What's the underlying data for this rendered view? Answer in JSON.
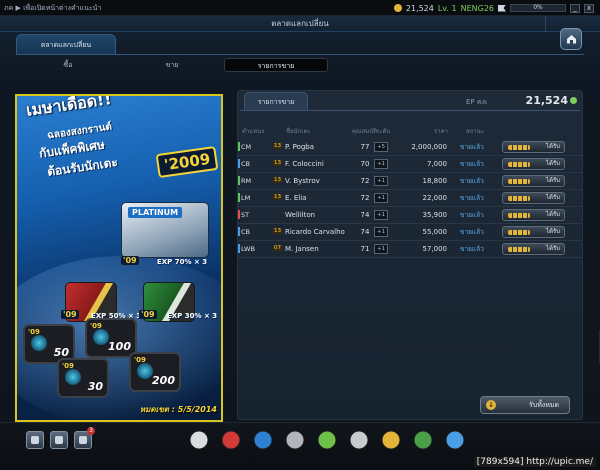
{
  "topbar": {
    "left_text": "ภค ▶ เพื่อเปิดหน้าต่างคำแนะนำ",
    "coins": "21,524",
    "level": "Lv. 1",
    "username": "NENG26",
    "progress_text": "0%",
    "minimize": "_",
    "close": "x"
  },
  "window": {
    "title": "ตลาดแลกเปลี่ยน",
    "main_tab": "ตลาดแลกเปลี่ยน",
    "subtabs": [
      "ซื้อ",
      "ขาย",
      "รายการขาย"
    ],
    "active_subtab": 2
  },
  "promo": {
    "headline": "เมษาเดือด!!",
    "line2": "ฉลองสงกรานต์",
    "line3": "กับแพ็คพิเศษ",
    "line4": "ต้อนรับนักเตะ",
    "year": "'2009",
    "platinum_label": "PLATINUM",
    "tag09": "'09",
    "exp_platinum": "EXP 70% × 3",
    "exp_red": "EXP 50% × 3",
    "exp_green": "EXP 30% × 3",
    "card_values": [
      "50",
      "100",
      "30",
      "200"
    ],
    "deadline": "หมดเขต : 5/5/2014"
  },
  "panel": {
    "tab": "รายการขาย",
    "ep_label": "EP คงเ",
    "ep_value": "21,524",
    "columns": [
      "ตำแหน่ง",
      "ชื่อนักเตะ",
      "คุณสมบัติ",
      "ระดับ",
      "ราคา",
      "สถานะ"
    ],
    "rows": [
      {
        "pos": "CM",
        "pos_color": "#5ac85a",
        "season": "13",
        "name": "P. Pogba",
        "ovr": "77",
        "lvl": "+5",
        "price": "2,000,000",
        "status": "ขายแล้ว",
        "action": "ได้รับ"
      },
      {
        "pos": "CB",
        "pos_color": "#4aa0e8",
        "season": "13",
        "name": "F. Coloccini",
        "ovr": "70",
        "lvl": "+1",
        "price": "7,000",
        "status": "ขายแล้ว",
        "action": "ได้รับ"
      },
      {
        "pos": "RM",
        "pos_color": "#5ac85a",
        "season": "13",
        "name": "V. Bystrov",
        "ovr": "72",
        "lvl": "+1",
        "price": "18,800",
        "status": "ขายแล้ว",
        "action": "ได้รับ"
      },
      {
        "pos": "LM",
        "pos_color": "#5ac85a",
        "season": "13",
        "name": "E. Elia",
        "ovr": "72",
        "lvl": "+1",
        "price": "22,000",
        "status": "ขายแล้ว",
        "action": "ได้รับ"
      },
      {
        "pos": "ST",
        "pos_color": "#e05050",
        "season": "",
        "name": "Wellilton",
        "ovr": "74",
        "lvl": "+1",
        "price": "35,900",
        "status": "ขายแล้ว",
        "action": "ได้รับ"
      },
      {
        "pos": "CB",
        "pos_color": "#4aa0e8",
        "season": "13",
        "name": "Ricardo Carvalho",
        "ovr": "74",
        "lvl": "+1",
        "price": "55,000",
        "status": "ขายแล้ว",
        "action": "ได้รับ"
      },
      {
        "pos": "LWB",
        "pos_color": "#4aa0e8",
        "season": "07",
        "name": "M. Jansen",
        "ovr": "71",
        "lvl": "+1",
        "price": "57,000",
        "status": "ขายแล้ว",
        "action": "ได้รับ"
      }
    ],
    "receive_all": "รับทั้งหมด"
  },
  "bottombar": {
    "mail_badge": "3",
    "icons": [
      "whistle-icon",
      "ball-icon",
      "boot-icon",
      "trophy-icon",
      "pyramid-icon",
      "notebook-icon",
      "coin-jar-icon",
      "club-icon",
      "basket-icon"
    ]
  },
  "footer": {
    "credit": "[789x594] http://upic.me/"
  }
}
